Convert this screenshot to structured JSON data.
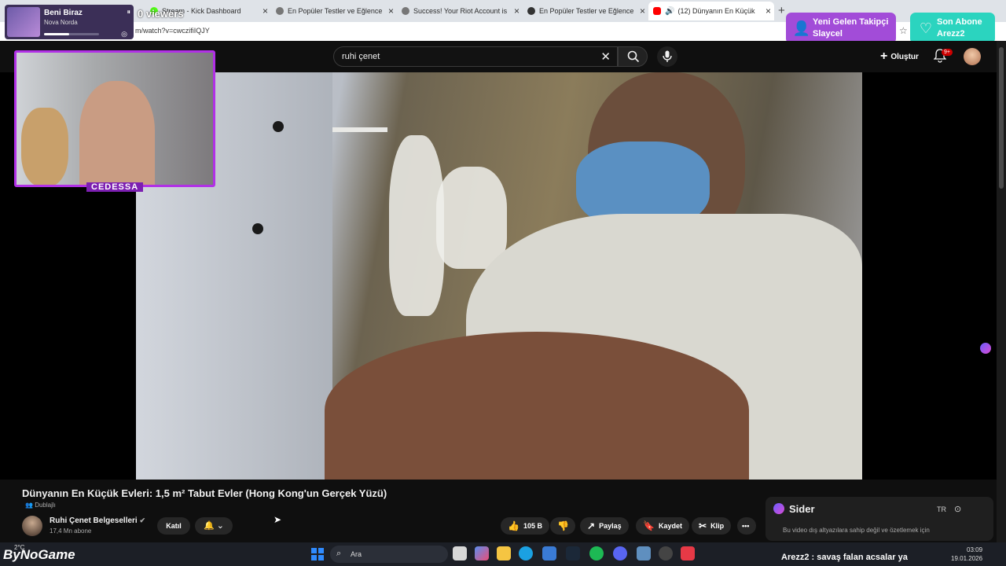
{
  "now_playing": {
    "title": "Beni Biraz",
    "artist": "Nova Norda",
    "progress": 0.45
  },
  "stream": {
    "viewers": "0 viewers"
  },
  "browser": {
    "tabs": [
      {
        "title": "Stream - Kick Dashboard",
        "favicon_color": "#53fc18",
        "active": false
      },
      {
        "title": "En Popüler Testler ve Eğlenceli Qu",
        "favicon_color": "#777777",
        "active": false
      },
      {
        "title": "Success! Your Riot Account is now",
        "favicon_color": "#777777",
        "active": false
      },
      {
        "title": "En Popüler Testler ve Eğlenceli Qu",
        "favicon_color": "#333333",
        "active": false
      },
      {
        "title": "(12) Dünyanın En Küçük Evler",
        "favicon_color": "#ff0000",
        "active": true
      }
    ],
    "url": "m/watch?v=cwczifiIQJY"
  },
  "alerts": {
    "follower": {
      "heading": "Yeni Gelen Takipçi",
      "name": "Slaycel",
      "color": "#a24cd8"
    },
    "subscriber": {
      "heading": "Son Abone",
      "name": "Arezz2",
      "color": "#2bd4bf"
    }
  },
  "youtube": {
    "search_query": "ruhi çenet",
    "create_label": "Oluştur",
    "notifications_badge": "9+",
    "video_title": "Dünyanın En Küçük Evleri: 1,5 m² Tabut Evler (Hong Kong'un Gerçek Yüzü)",
    "dubbed_label": "Dublajlı",
    "channel": {
      "name": "Ruhi Çenet Belgeselleri",
      "subscribers": "17,4 Mn abone"
    },
    "join_label": "Katıl",
    "actions": {
      "likes": "105 B",
      "share": "Paylaş",
      "save": "Kaydet",
      "clip": "Klip"
    }
  },
  "webcam": {
    "name": "CEDESSA",
    "border_color": "#b130e6"
  },
  "sider": {
    "name": "Sider",
    "language": "TR",
    "message": "Bu video dış altyazılara sahip değil ve özetlemek için"
  },
  "taskbar": {
    "weather": "2°C",
    "watermark": "ByNoGame",
    "search_placeholder": "Ara",
    "ticker": "Arezz2 : savaş falan acsalar ya",
    "time": "03:09",
    "date": "19.01.2026"
  }
}
